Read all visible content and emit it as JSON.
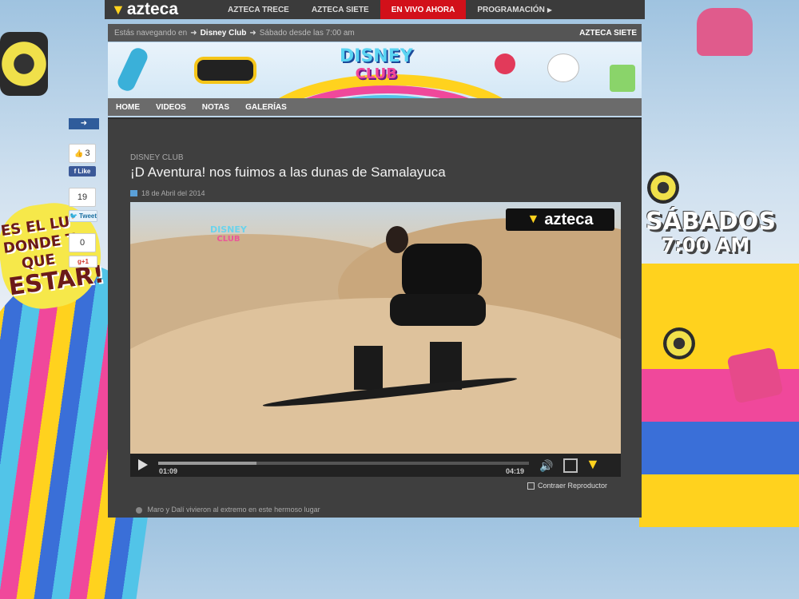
{
  "brand": {
    "logo_text": "azteca",
    "logo_icon": "azteca-logo-icon"
  },
  "topnav": {
    "items": [
      {
        "label": "AZTECA TRECE"
      },
      {
        "label": "AZTECA SIETE"
      },
      {
        "label": "EN VIVO AHORA",
        "live": true
      },
      {
        "label": "PROGRAMACIÓN"
      }
    ],
    "live_color": "#d2101a"
  },
  "breadcrumb": {
    "prefix": "Estás navegando en",
    "section": "Disney Club",
    "schedule": "Sábado desde las 7:00 am",
    "channel": "AZTECA SIETE"
  },
  "banner": {
    "title_line1": "DISNEY",
    "title_line2": "CLUB"
  },
  "mainnav": {
    "items": [
      {
        "label": "HOME"
      },
      {
        "label": "VIDEOS"
      },
      {
        "label": "NOTAS"
      },
      {
        "label": "GALERÍAS"
      }
    ]
  },
  "share": {
    "toggle_icon": "arrow-right-icon",
    "facebook": {
      "count": "3",
      "label": "Like"
    },
    "twitter": {
      "count": "19",
      "label": "Tweet"
    },
    "google": {
      "count": "0",
      "label": "+1"
    }
  },
  "article": {
    "kicker": "DISNEY CLUB",
    "headline": "¡D Aventura! nos fuimos a las dunas de Samalayuca",
    "date": "18 de Abril del 2014",
    "caption": "Maro y Dalí vivieron al extremo en este hermoso lugar"
  },
  "player": {
    "watermark": "azteca",
    "overlay_line1": "DISNEY",
    "overlay_line2": "CLUB",
    "current_time": "01:09",
    "duration": "04:19",
    "progress": 0.266,
    "collapse_label": "Contraer Reproductor"
  },
  "side_promo": {
    "left_line1": "ES EL LU",
    "left_line2": "DONDE T",
    "left_line3": "QUE",
    "left_line4": "ESTAR!",
    "right_line1": "SÁBADOS",
    "right_line2": "7:00 AM"
  },
  "colors": {
    "panel": "#3f3f3f",
    "topbar": "#3b3b3b",
    "accent_yellow": "#ffd21e",
    "accent_pink": "#f0489b"
  }
}
